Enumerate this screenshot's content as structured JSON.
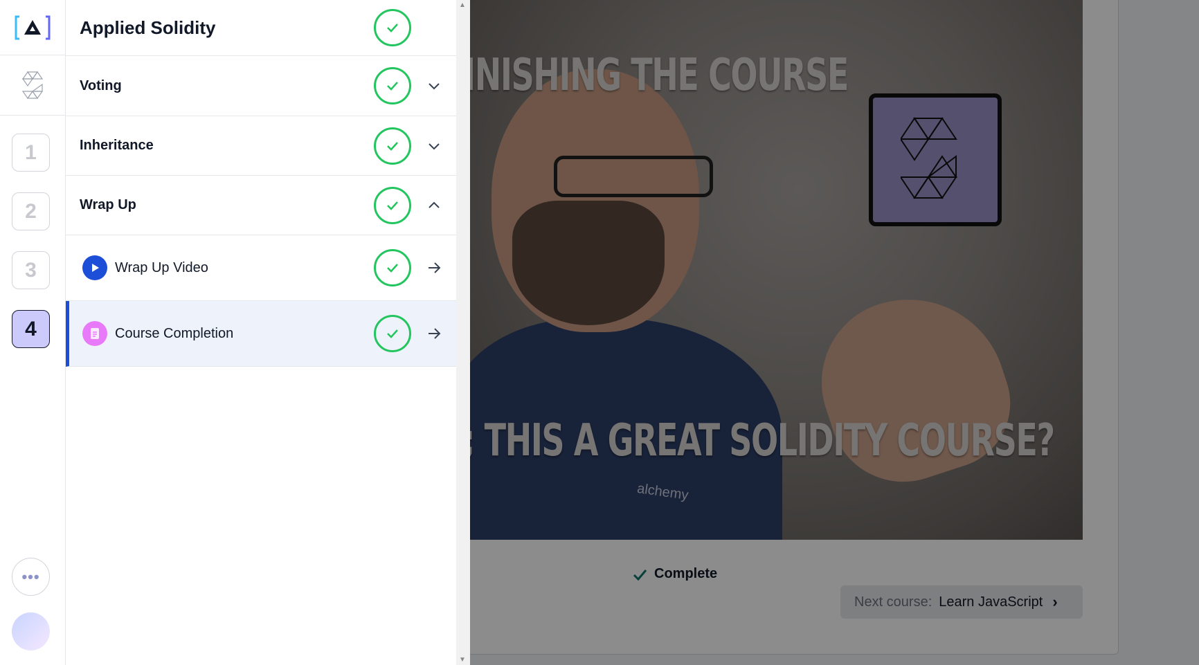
{
  "colors": {
    "accent": "#1d4ed8",
    "complete_green": "#22c55e",
    "active_chapter_bg": "#ccc9fb",
    "doc_icon": "#e879f9"
  },
  "logo": {
    "icon": "alchemy-bracket-logo"
  },
  "rail": {
    "course_icon": "solidity-icon",
    "chapters": [
      "1",
      "2",
      "3",
      "4"
    ],
    "active_chapter": "4",
    "more_icon": "ellipsis-icon",
    "more_label": "•••"
  },
  "panel": {
    "course_title": "Applied Solidity",
    "sections": [
      {
        "title": "Voting",
        "complete": true,
        "expanded": false
      },
      {
        "title": "Inheritance",
        "complete": true,
        "expanded": false
      },
      {
        "title": "Wrap Up",
        "complete": true,
        "expanded": true
      }
    ],
    "lessons": [
      {
        "title": "Wrap Up Video",
        "icon": "play-icon",
        "complete": true
      },
      {
        "title": "Course Completion",
        "icon": "document-icon",
        "complete": true,
        "active": true
      }
    ]
  },
  "video": {
    "caption_top": "INISHING THE COURSE",
    "caption_bottom": "; THIS A GREAT SOLIDITY COURSE?",
    "shirt_text": "alchemy"
  },
  "footer": {
    "complete_label": "Complete",
    "next_prefix": "Next course:",
    "next_title": "Learn JavaScript",
    "next_chevron": "›"
  },
  "scrollbar": {
    "up": "▲",
    "down": "▼"
  }
}
